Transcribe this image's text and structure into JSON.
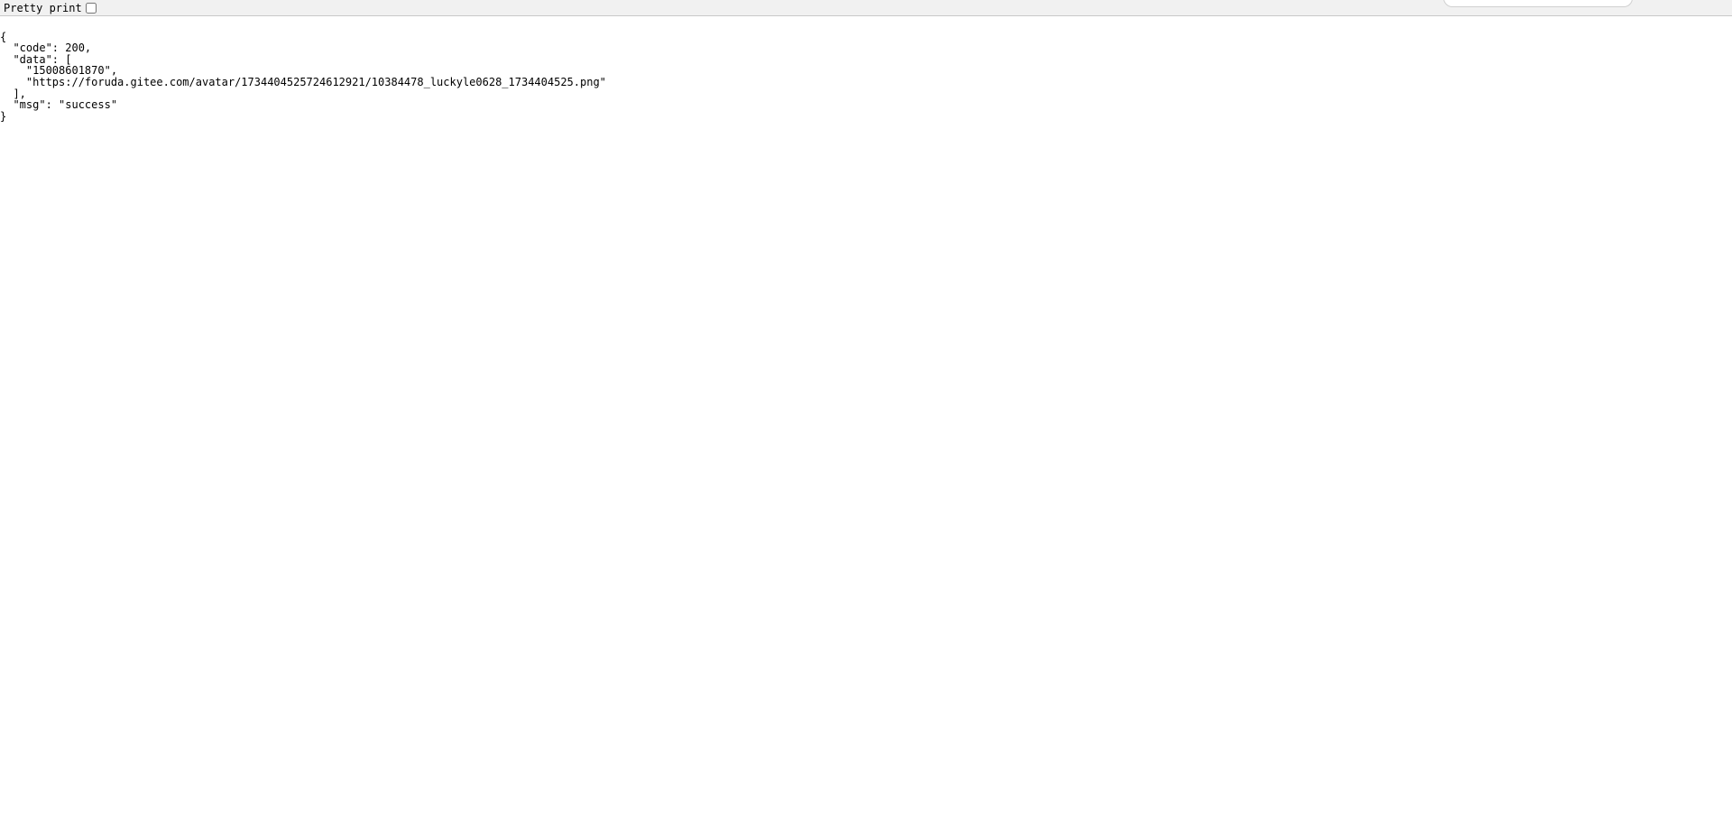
{
  "toolbar": {
    "pretty_print_label": "Pretty print"
  },
  "json_lines": {
    "l0": "{",
    "l1": "  \"code\": 200,",
    "l2": "  \"data\": [",
    "l3": "    \"15008601870\",",
    "l4": "    \"https://foruda.gitee.com/avatar/1734404525724612921/10384478_luckyle0628_1734404525.png\"",
    "l5": "  ],",
    "l6": "  \"msg\": \"success\"",
    "l7": "}"
  }
}
